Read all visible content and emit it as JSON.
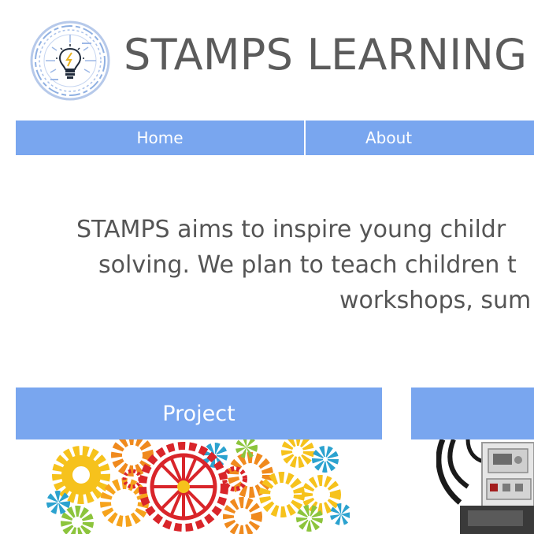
{
  "header": {
    "site_title": "STAMPS LEARNING",
    "logo_icon": "lightbulb-logo-icon"
  },
  "nav": {
    "items": [
      {
        "label": "Home"
      },
      {
        "label": "About"
      }
    ]
  },
  "intro": {
    "lines": [
      "STAMPS aims to inspire young childr",
      "solving. We plan to teach children t",
      "workshops, sum"
    ]
  },
  "sections": [
    {
      "label": "Project",
      "image_icon": "colorful-gears-image"
    },
    {
      "label": "",
      "image_icon": "lego-robot-image"
    }
  ],
  "colors": {
    "accent": "#79a6ef",
    "title_text": "#5b5b5b",
    "body_text": "#555555"
  }
}
